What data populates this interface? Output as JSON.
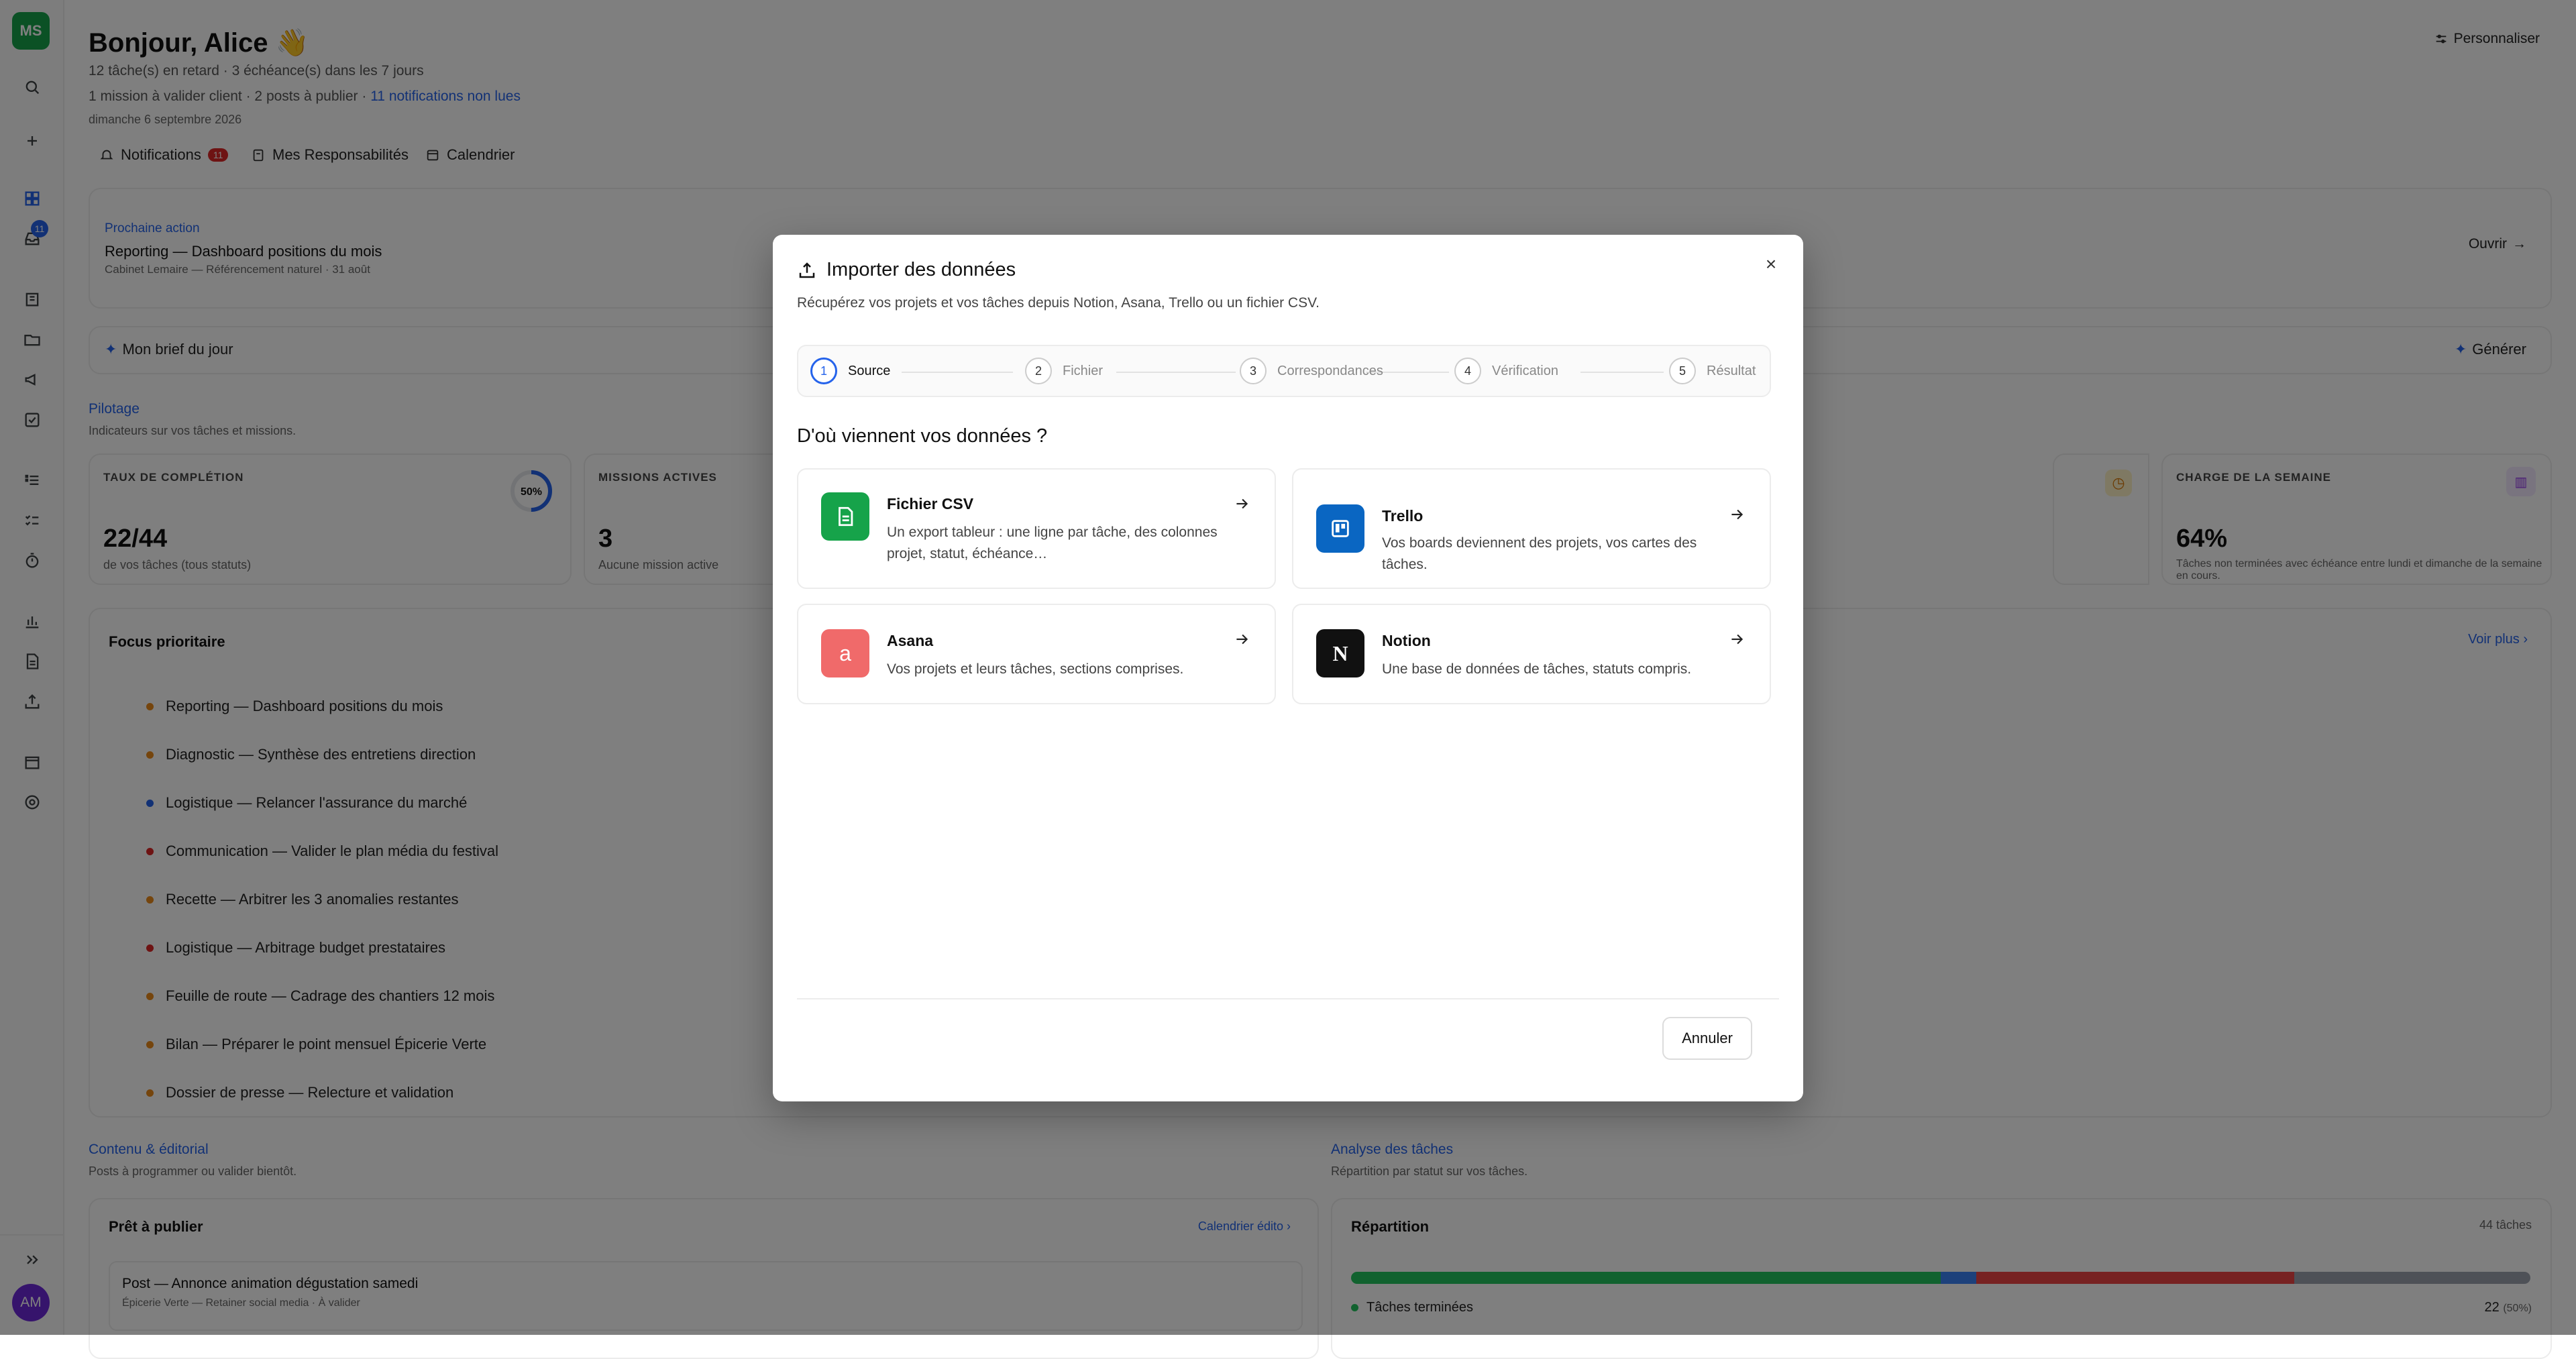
{
  "sidebar": {
    "logo": "MS",
    "avatar": "AM",
    "inbox_badge": "11"
  },
  "header": {
    "greeting": "Bonjour, Alice 👋",
    "line1": "12 tâche(s) en retard · 3 échéance(s) dans les 7 jours",
    "line2_prefix": "1 mission à valider client · 2 posts à publier · ",
    "line2_link": "11 notifications non lues",
    "date": "dimanche 6 septembre 2026",
    "personalize": "Personnaliser"
  },
  "tabs": {
    "notifications": "Notifications",
    "notifications_badge": "11",
    "responsibilities": "Mes Responsabilités",
    "calendar": "Calendrier"
  },
  "next_action": {
    "eyebrow": "Prochaine action",
    "title": "Reporting — Dashboard positions du mois",
    "meta": "Cabinet Lemaire — Référencement naturel · 31 août",
    "open": "Ouvrir"
  },
  "brief": {
    "title": "Mon brief du jour",
    "generate": "Générer"
  },
  "pilotage": {
    "title": "Pilotage",
    "subtitle": "Indicateurs sur vos tâches et missions.",
    "kpis": [
      {
        "label": "TAUX DE COMPLÉTION",
        "value": "22/44",
        "sub": "de vos tâches (tous statuts)",
        "ring": "50%",
        "ring_fraction": 0.5
      },
      {
        "label": "MISSIONS ACTIVES",
        "value": "3",
        "sub": "Aucune mission active"
      },
      {
        "label": "CHARGE DE LA SEMAINE",
        "value": "64%",
        "sub": "Tâches non terminées avec échéance entre lundi et dimanche de la semaine en cours."
      }
    ]
  },
  "focus": {
    "title": "Focus prioritaire",
    "more": "Voir plus",
    "items": [
      {
        "text": "Reporting — Dashboard positions du mois",
        "color": "#ea8a1a"
      },
      {
        "text": "Diagnostic — Synthèse des entretiens direction",
        "color": "#ea8a1a"
      },
      {
        "text": "Logistique — Relancer l'assurance du marché",
        "color": "#2563eb"
      },
      {
        "text": "Communication — Valider le plan média du festival",
        "color": "#dc2626"
      },
      {
        "text": "Recette — Arbitrer les 3 anomalies restantes",
        "color": "#ea8a1a"
      },
      {
        "text": "Logistique — Arbitrage budget prestataires",
        "color": "#dc2626"
      },
      {
        "text": "Feuille de route — Cadrage des chantiers 12 mois",
        "color": "#ea8a1a"
      },
      {
        "text": "Bilan — Préparer le point mensuel Épicerie Verte",
        "color": "#ea8a1a"
      },
      {
        "text": "Dossier de presse — Relecture et validation",
        "color": "#ea8a1a"
      }
    ]
  },
  "content": {
    "title": "Contenu & éditorial",
    "subtitle": "Posts à programmer ou valider bientôt.",
    "ready_title": "Prêt à publier",
    "calendar_link": "Calendrier édito",
    "post_title": "Post — Annonce animation dégustation samedi",
    "post_meta": "Épicerie Verte — Retainer social media · À valider"
  },
  "analysis": {
    "title": "Analyse des tâches",
    "subtitle": "Répartition par statut sur vos tâches.",
    "dist_title": "Répartition",
    "total": "44 tâches",
    "done_label": "Tâches terminées",
    "done_value": "22",
    "done_pct": "(50%)",
    "segments": [
      {
        "fraction": 0.5,
        "color": "#22c55e"
      },
      {
        "fraction": 0.03,
        "color": "#3b82f6"
      },
      {
        "fraction": 0.27,
        "color": "#ef4444"
      },
      {
        "fraction": 0.2,
        "color": "#9ca3af"
      }
    ]
  },
  "modal": {
    "title": "Importer des données",
    "description": "Récupérez vos projets et vos tâches depuis Notion, Asana, Trello ou un fichier CSV.",
    "steps": [
      {
        "num": "1",
        "label": "Source"
      },
      {
        "num": "2",
        "label": "Fichier"
      },
      {
        "num": "3",
        "label": "Correspondances"
      },
      {
        "num": "4",
        "label": "Vérification"
      },
      {
        "num": "5",
        "label": "Résultat"
      }
    ],
    "question": "D'où viennent vos données ?",
    "sources": [
      {
        "title": "Fichier CSV",
        "desc": "Un export tableur : une ligne par tâche, des colonnes projet, statut, échéance…",
        "color": "#16a34a"
      },
      {
        "title": "Trello",
        "desc": "Vos boards deviennent des projets, vos cartes des tâches.",
        "color": "#0a66c2"
      },
      {
        "title": "Asana",
        "desc": "Vos projets et leurs tâches, sections comprises.",
        "color": "#f06a6a",
        "glyph": "a"
      },
      {
        "title": "Notion",
        "desc": "Une base de données de tâches, statuts compris.",
        "color": "#111111",
        "glyph": "N"
      }
    ],
    "cancel": "Annuler",
    "close": "×"
  }
}
